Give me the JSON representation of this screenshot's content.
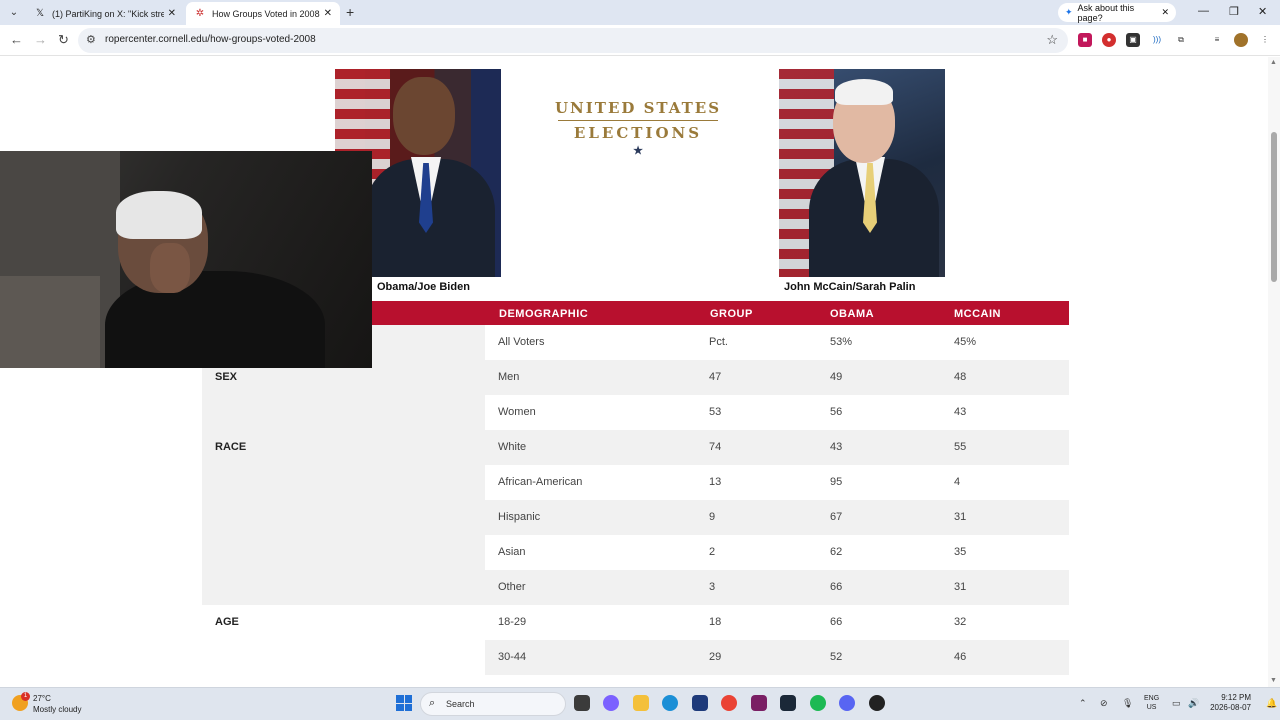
{
  "browser": {
    "tabs": [
      {
        "title": "(1) PartiKing on X: \"Kick stream",
        "favicon": "x-logo-icon"
      },
      {
        "title": "How Groups Voted in 2008 | Ro",
        "favicon": "roper-logo-icon"
      }
    ],
    "ask_button": "Ask about this page?",
    "url": "ropercenter.cornell.edu/how-groups-voted-2008"
  },
  "page": {
    "logo": {
      "line1": "UNITED STATES",
      "line2": "ELECTIONS"
    },
    "candidates": [
      {
        "caption": "Obama/Joe Biden"
      },
      {
        "caption": "John McCain/Sarah Palin"
      }
    ],
    "table": {
      "headers": {
        "demographic": "DEMOGRAPHIC",
        "group": "GROUP",
        "obama": "OBAMA",
        "mccain": "MCCAIN"
      },
      "sections": {
        "sex": "SEX",
        "race": "RACE",
        "age": "AGE"
      },
      "rows": [
        {
          "demographic": "All Voters",
          "group": "Pct.",
          "obama": "53%",
          "mccain": "45%"
        },
        {
          "demographic": "Men",
          "group": "47",
          "obama": "49",
          "mccain": "48"
        },
        {
          "demographic": "Women",
          "group": "53",
          "obama": "56",
          "mccain": "43"
        },
        {
          "demographic": "White",
          "group": "74",
          "obama": "43",
          "mccain": "55"
        },
        {
          "demographic": "African-American",
          "group": "13",
          "obama": "95",
          "mccain": "4"
        },
        {
          "demographic": "Hispanic",
          "group": "9",
          "obama": "67",
          "mccain": "31"
        },
        {
          "demographic": "Asian",
          "group": "2",
          "obama": "62",
          "mccain": "35"
        },
        {
          "demographic": "Other",
          "group": "3",
          "obama": "66",
          "mccain": "31"
        },
        {
          "demographic": "18-29",
          "group": "18",
          "obama": "66",
          "mccain": "32"
        },
        {
          "demographic": "30-44",
          "group": "29",
          "obama": "52",
          "mccain": "46"
        }
      ]
    },
    "colors": {
      "header_bg": "#b8102e",
      "logo_gold": "#9a7a3a"
    }
  },
  "taskbar": {
    "weather": {
      "temp": "27°C",
      "desc": "Mostly cloudy",
      "badge": "1"
    },
    "search_label": "Search",
    "lang": {
      "l1": "ENG",
      "l2": "US"
    },
    "clock": {
      "time": "9:12 PM",
      "date": "2026-08-07"
    }
  }
}
